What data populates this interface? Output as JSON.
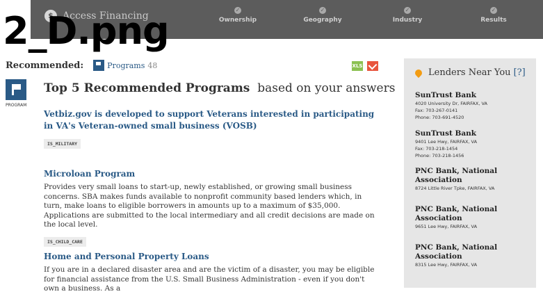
{
  "watermark": "2_D.png",
  "header": {
    "brand": "Access Financing",
    "steps": [
      "Ownership",
      "Geography",
      "Industry",
      "Results"
    ]
  },
  "recommend": {
    "label": "Recommended:",
    "programs_label": "Programs",
    "count": "48",
    "export_xls": "XLS",
    "badge_label": "PROGRAM"
  },
  "main": {
    "title_bold": "Top 5 Recommended Programs",
    "title_rest": "based on your answers",
    "programs": [
      {
        "title": "Vetbiz.gov is developed to support Veterans interested in participating in VA's Veteran-owned small business (VOSB)",
        "desc": "",
        "tag": "IS_MILITARY"
      },
      {
        "title": "Microloan Program",
        "desc": "Provides very small loans to start-up, newly established, or growing small business concerns. SBA makes funds available to nonprofit community based lenders which, in turn, make loans to eligible borrowers in amounts up to a maximum of $35,000. Applications are submitted to the local intermediary and all credit decisions are made on the local level.",
        "tag": "IS_CHILD_CARE"
      },
      {
        "title": "Home and Personal Property Loans",
        "desc": "If you are in a declared disaster area and are the victim of a disaster, you may be eligible for financial assistance from the U.S. Small Business Administration - even if you don't own a business. As a",
        "tag": ""
      }
    ]
  },
  "sidebar": {
    "title": "Lenders Near You",
    "help": "[?]",
    "lenders": [
      {
        "name": "SunTrust Bank",
        "address": "4020 University Dr, FAIRFAX, VA",
        "fax": "Fax:  703-267-0141",
        "phone": "Phone:  703-691-4520"
      },
      {
        "name": "SunTrust Bank",
        "address": "9401 Lee Hwy, FAIRFAX, VA",
        "fax": "Fax:  703-218-1454",
        "phone": "Phone:  703-218-1456"
      },
      {
        "name": "PNC Bank, National Association",
        "address": "8724 Little River Tpke, FAIRFAX, VA",
        "fax": "",
        "phone": ""
      },
      {
        "name": "PNC Bank, National Association",
        "address": "9651 Lee Hwy, FAIRFAX, VA",
        "fax": "",
        "phone": ""
      },
      {
        "name": "PNC Bank, National Association",
        "address": "8315 Lee Hwy, FAIRFAX, VA",
        "fax": "",
        "phone": ""
      }
    ]
  }
}
